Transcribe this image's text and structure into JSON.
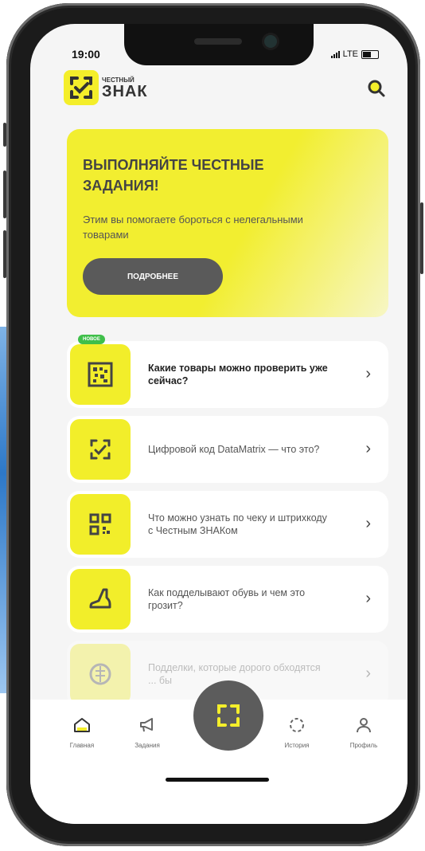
{
  "status": {
    "time": "19:00",
    "network": "LTE"
  },
  "brand": {
    "small": "ЧЕСТНЫЙ",
    "big": "ЗНАК",
    "accent": "#f4ee2a"
  },
  "hero": {
    "title": "ВЫПОЛНЯЙТЕ ЧЕСТНЫЕ ЗАДАНИЯ!",
    "subtitle": "Этим вы помогаете бороться с нелегальными товарами",
    "button": "ПОДРОБНЕЕ"
  },
  "cards": [
    {
      "badge": "НОВОЕ",
      "text": "Какие товары можно проверить уже сейчас?",
      "icon": "datamatrix-icon"
    },
    {
      "text": "Цифровой код DataMatrix — что это?",
      "icon": "scan-check-icon"
    },
    {
      "text": "Что можно узнать по чеку и штрихкоду с Честным ЗНАКом",
      "icon": "qr-code-icon"
    },
    {
      "text": "Как подделывают обувь и чем это грозит?",
      "icon": "shoe-icon"
    },
    {
      "text": "Подделки, которые дорого обходятся ... бы",
      "icon": "product-icon"
    }
  ],
  "tabs": {
    "home": "Главная",
    "tasks": "Задания",
    "history": "История",
    "profile": "Профиль"
  }
}
